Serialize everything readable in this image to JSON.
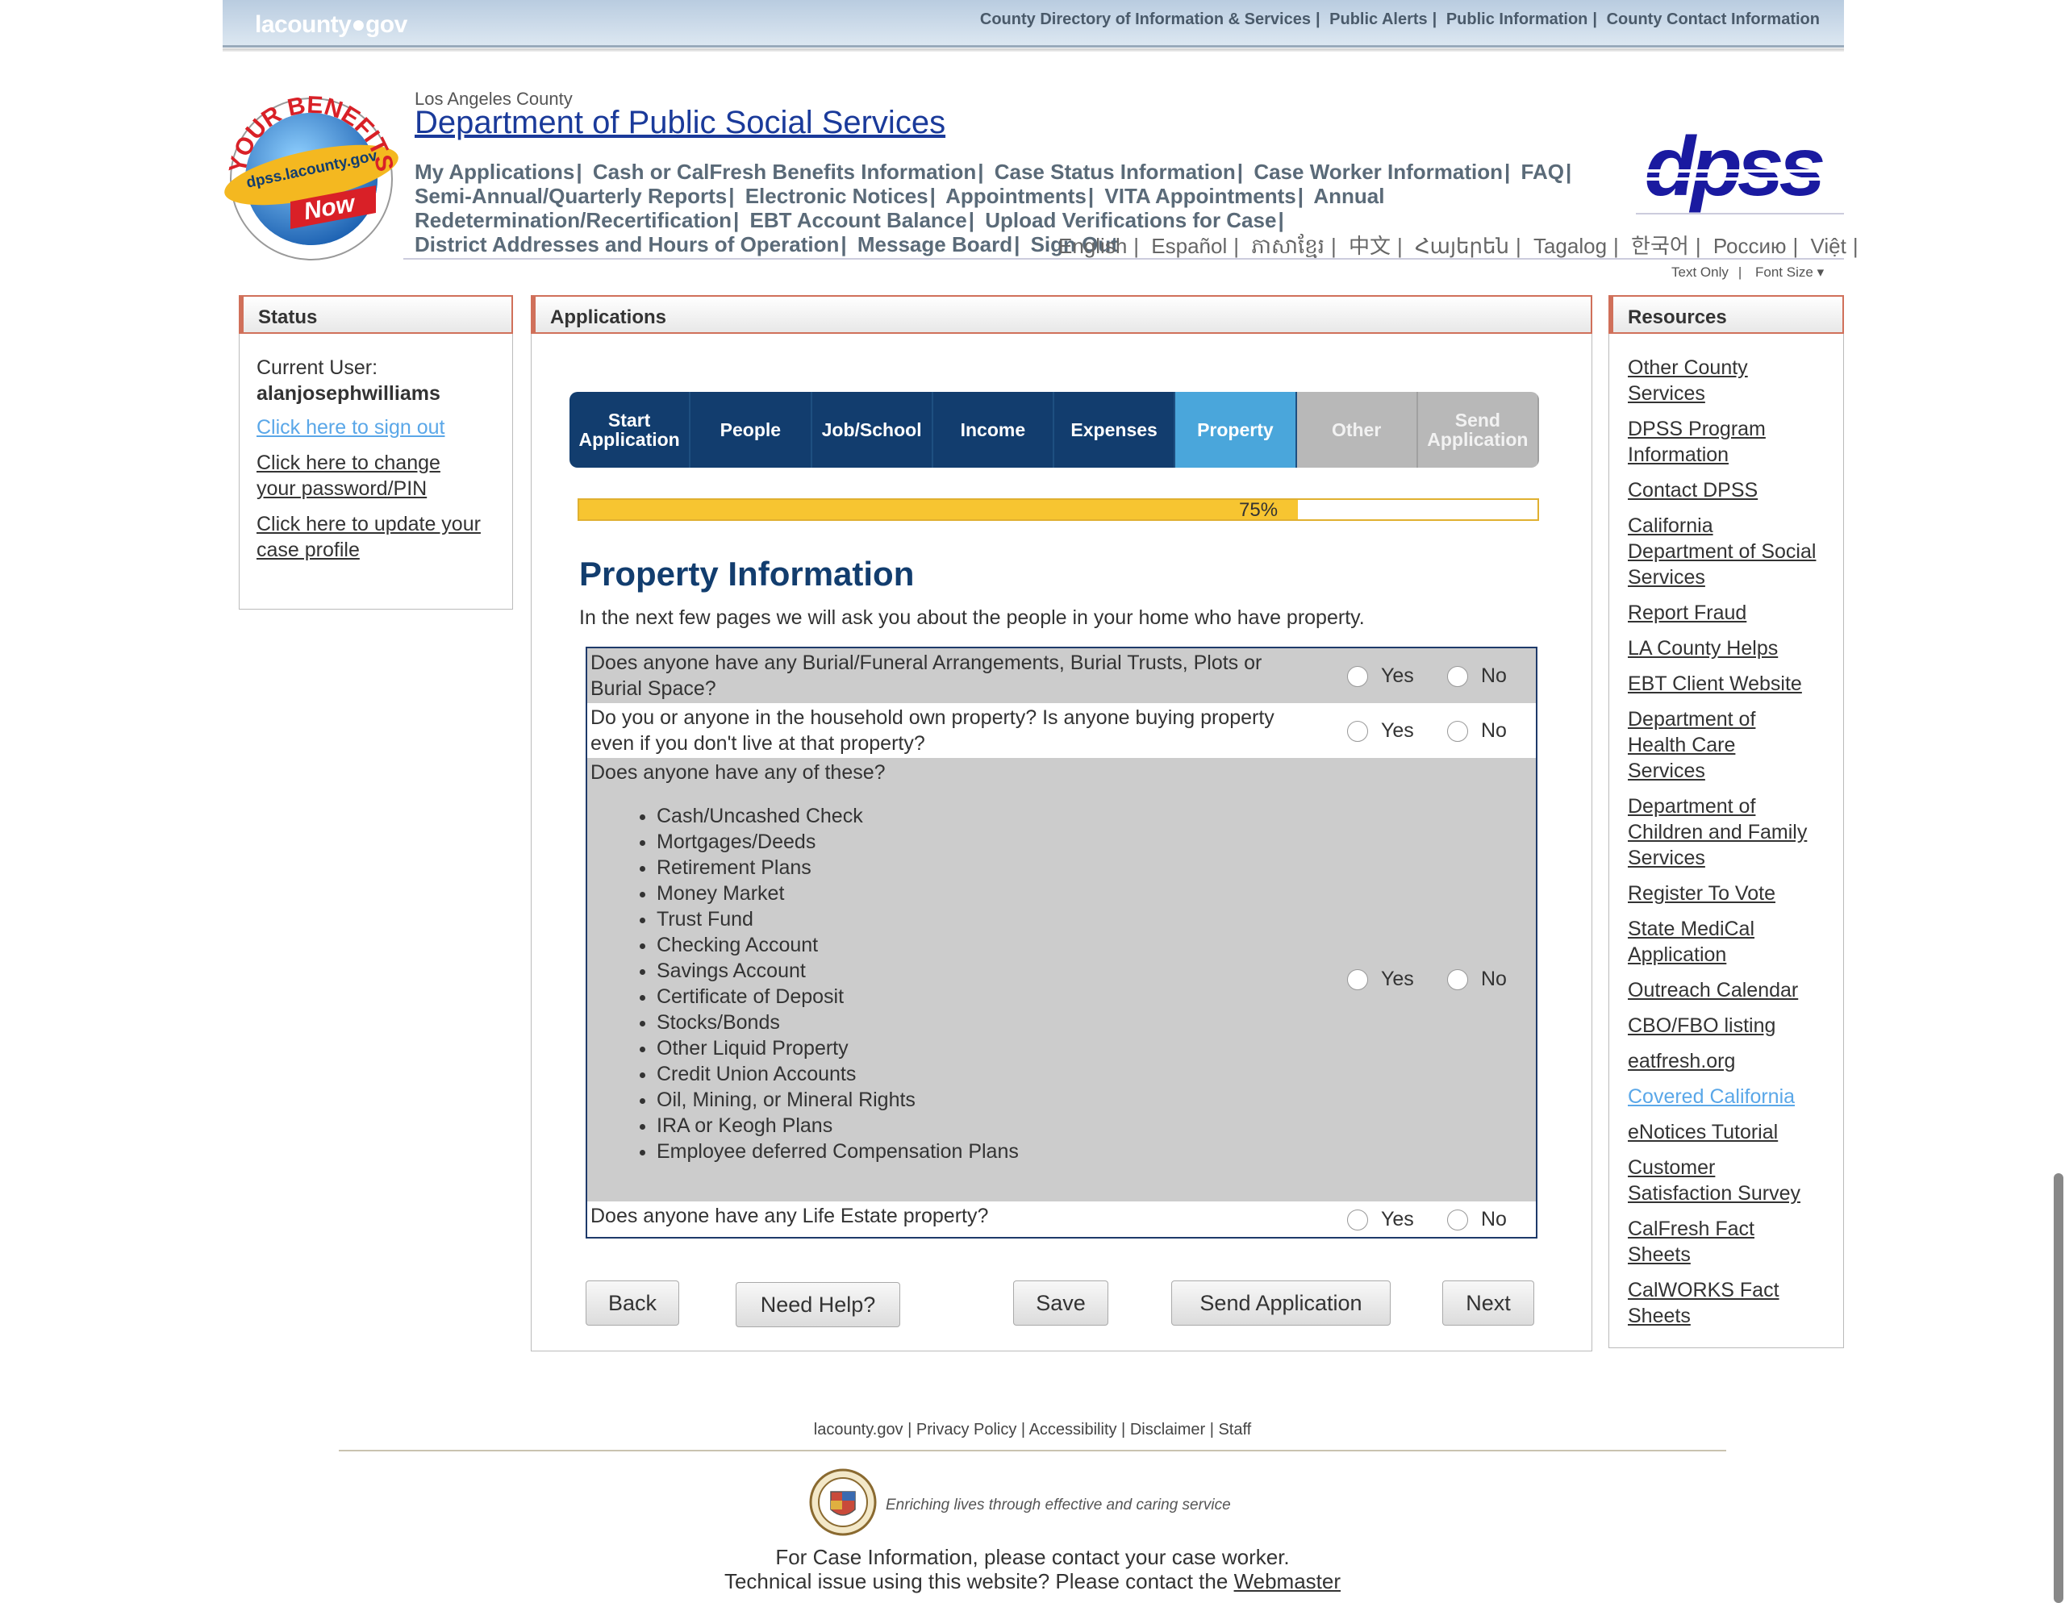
{
  "topbar": {
    "logo": "lacounty●gov",
    "links": [
      "County Directory of Information & Services",
      "Public Alerts",
      "Public Information",
      "County Contact Information"
    ]
  },
  "header": {
    "badge_text": "YOUR BENEFITS",
    "badge_url": "dpss.lacounty.gov",
    "badge_now": "Now",
    "subtitle": "Los Angeles County",
    "title": "Department of Public Social Services",
    "dpss_logo": "dpss",
    "nav": [
      "My Applications",
      "Cash or CalFresh Benefits Information",
      "Case Status Information",
      "Case Worker Information",
      "FAQ",
      "Semi-Annual/Quarterly Reports",
      "Electronic Notices",
      "Appointments",
      "VITA Appointments",
      "Annual Redetermination/Recertification",
      "EBT Account Balance",
      "Upload Verifications for Case",
      "District Addresses and Hours of Operation",
      "Message Board",
      "Sign Out"
    ],
    "languages": [
      "English",
      "Español",
      "ភាសាខ្មែរ",
      "中文",
      "Հայերեն",
      "Tagalog",
      "한국어",
      "Россию",
      "Việt"
    ],
    "text_only": "Text Only",
    "font_size": "Font Size"
  },
  "status": {
    "heading": "Status",
    "current_user_label": "Current User:",
    "username": "alanjosephwilliams",
    "sign_out": "Click here to sign out",
    "change_pw_1": "Click here to change",
    "change_pw_2": "your password/PIN",
    "update_1": "Click here to update your",
    "update_2": "case profile"
  },
  "applications": {
    "heading": "Applications",
    "steps": [
      {
        "label1": "Start",
        "label2": "Application",
        "state": "done"
      },
      {
        "label1": "People",
        "label2": "",
        "state": "done"
      },
      {
        "label1": "Job/School",
        "label2": "",
        "state": "done"
      },
      {
        "label1": "Income",
        "label2": "",
        "state": "done"
      },
      {
        "label1": "Expenses",
        "label2": "",
        "state": "done"
      },
      {
        "label1": "Property",
        "label2": "",
        "state": "current"
      },
      {
        "label1": "Other",
        "label2": "",
        "state": "todo"
      },
      {
        "label1": "Send",
        "label2": "Application",
        "state": "todo"
      }
    ],
    "progress_value": 0.75,
    "progress_label": "75%",
    "section_title": "Property Information",
    "intro": "In the next few pages we will ask you about the people in your home who have property.",
    "questions": [
      {
        "text": "Does anyone have any Burial/Funeral Arrangements, Burial Trusts, Plots or Burial Space?",
        "yes": "Yes",
        "no": "No"
      },
      {
        "text": "Do you or anyone in the household own property? Is anyone buying property even if you don't live at that property?",
        "yes": "Yes",
        "no": "No"
      },
      {
        "text": "Does anyone have any of these?",
        "yes": "Yes",
        "no": "No",
        "items": [
          "Cash/Uncashed Check",
          "Mortgages/Deeds",
          "Retirement Plans",
          "Money Market",
          "Trust Fund",
          "Checking Account",
          "Savings Account",
          "Certificate of Deposit",
          "Stocks/Bonds",
          "Other Liquid Property",
          "Credit Union Accounts",
          "Oil, Mining, or Mineral Rights",
          "IRA or Keogh Plans",
          "Employee deferred Compensation Plans"
        ]
      },
      {
        "text": "Does anyone have any Life Estate property?",
        "yes": "Yes",
        "no": "No"
      }
    ],
    "buttons": {
      "back": "Back",
      "help": "Need Help?",
      "save": "Save",
      "send": "Send Application",
      "next": "Next"
    }
  },
  "resources": {
    "heading": "Resources",
    "links": [
      [
        "Other County",
        "Services"
      ],
      [
        "DPSS Program",
        "Information"
      ],
      [
        "Contact DPSS"
      ],
      [
        "California",
        "Department of Social",
        "Services"
      ],
      [
        "Report Fraud"
      ],
      [
        "LA County Helps"
      ],
      [
        "EBT Client Website"
      ],
      [
        "Department of",
        "Health Care",
        "Services"
      ],
      [
        "Department of",
        "Children and Family",
        "Services"
      ],
      [
        "Register To Vote"
      ],
      [
        "State MediCal",
        "Application"
      ],
      [
        "Outreach Calendar"
      ],
      [
        "CBO/FBO listing"
      ],
      [
        "eatfresh.org"
      ],
      [
        "Covered California"
      ],
      [
        "eNotices Tutorial"
      ],
      [
        "Customer",
        "Satisfaction Survey"
      ],
      [
        "CalFresh Fact",
        "Sheets"
      ],
      [
        "CalWORKS Fact",
        "Sheets"
      ]
    ]
  },
  "footer": {
    "links": [
      "lacounty.gov",
      "Privacy Policy",
      "Accessibility",
      "Disclaimer",
      "Staff"
    ],
    "tagline": "Enriching lives through effective and caring service",
    "line1": "For Case Information, please contact your case worker.",
    "line2_prefix": "Technical issue using this website? Please contact the ",
    "webmaster": "Webmaster"
  },
  "colors": {
    "accent": "#123d6e",
    "current_step": "#4aa6db",
    "progress": "#f7c531",
    "panel_border": "#d0705a"
  }
}
